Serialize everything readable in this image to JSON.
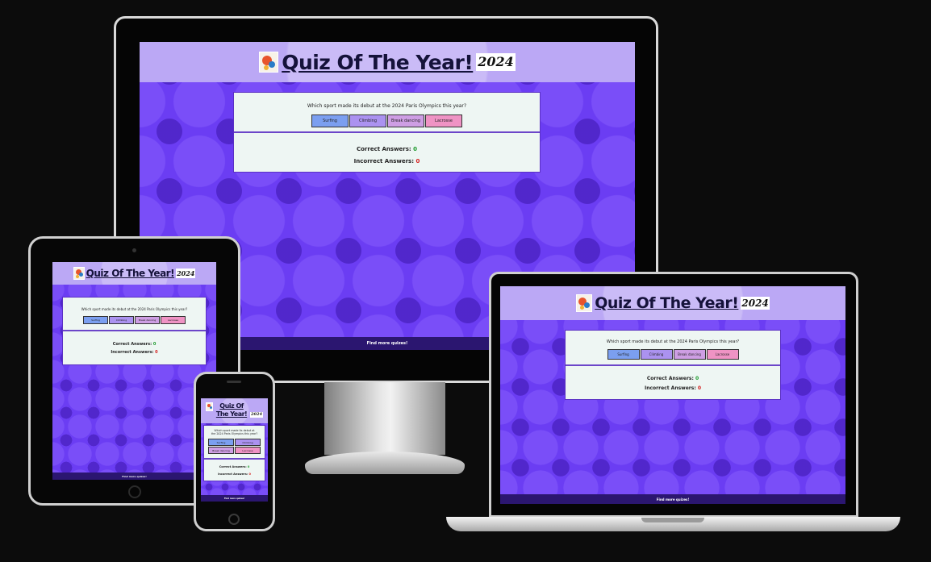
{
  "site": {
    "title": "Quiz Of The Year!",
    "year_badge": "2024",
    "question": "Which sport made its debut at the 2024 Paris Olympics this year?",
    "question_line1": "Which sport made its debut at",
    "question_line2": "the 2024 Paris Olympics this year?",
    "answers": [
      "Surfing",
      "Climbing",
      "Break dancing",
      "Lacrosse"
    ],
    "correct_label": "Correct Answers:",
    "correct_value": "0",
    "incorrect_label": "Incorrect Answers:",
    "incorrect_value": "0",
    "footer_text": "Find more quizes!"
  },
  "colors": {
    "page_background": "#0c0c0c",
    "site_background": "#6b3df3",
    "header_background": "#bba8f5",
    "footer_background": "#2b1670",
    "card_background": "#eef6f3",
    "answer_1": "#7b9ff0",
    "answer_2": "#ab92f0",
    "answer_3": "#ce9ee4",
    "answer_4": "#ef93c4",
    "correct_count": "#1b9a2b",
    "incorrect_count": "#d4201e"
  },
  "icons": [
    "quiz-logo-icon",
    "year-2024-badge",
    "home-button-icon",
    "camera-icon"
  ]
}
